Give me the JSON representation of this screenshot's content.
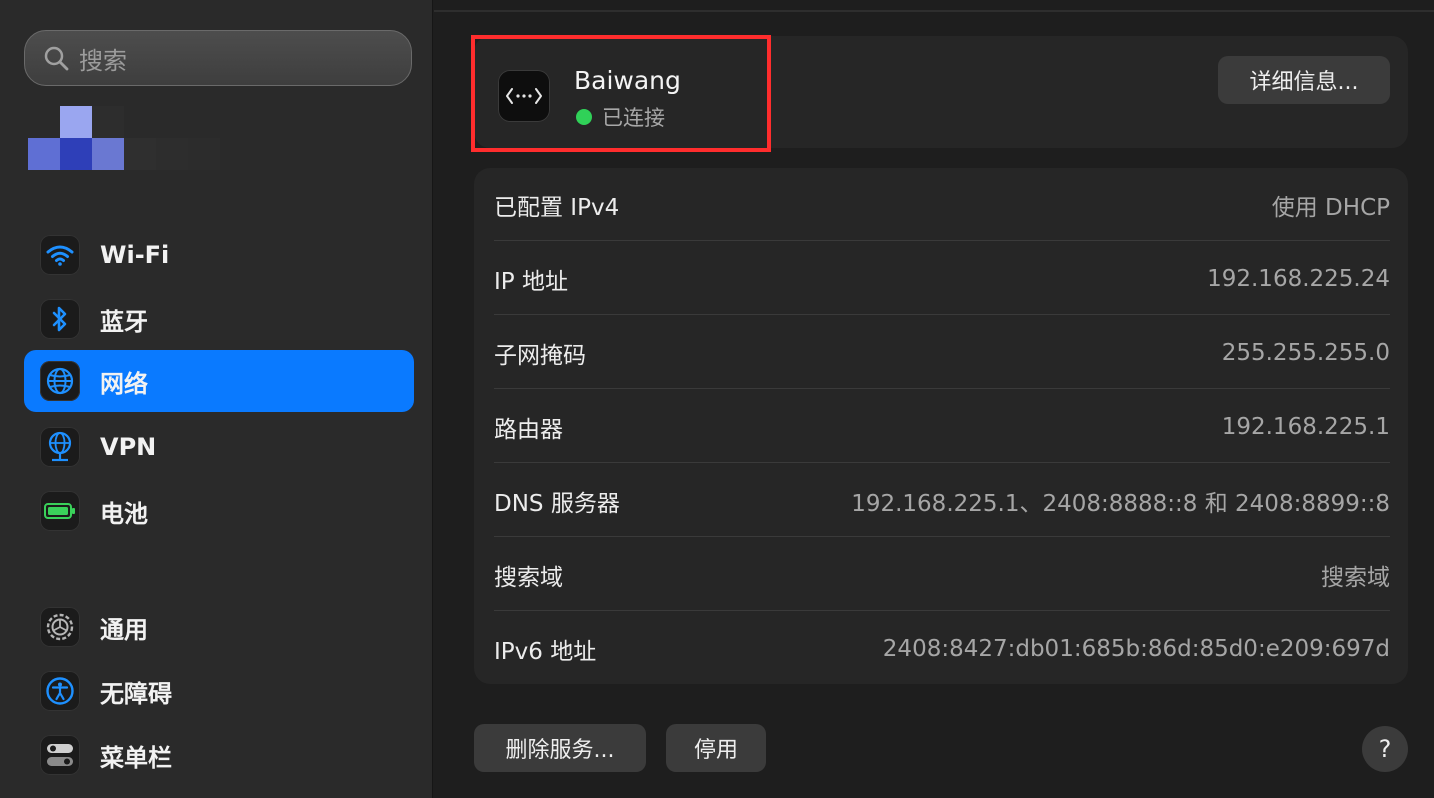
{
  "sidebar": {
    "search_placeholder": "搜索",
    "items": [
      {
        "label": "Wi-Fi",
        "icon": "wifi-icon"
      },
      {
        "label": "蓝牙",
        "icon": "bluetooth-icon"
      },
      {
        "label": "网络",
        "icon": "globe-icon",
        "active": true
      },
      {
        "label": "VPN",
        "icon": "vpn-globe-icon"
      },
      {
        "label": "电池",
        "icon": "battery-icon"
      },
      {
        "label": "通用",
        "icon": "gear-icon"
      },
      {
        "label": "无障碍",
        "icon": "accessibility-icon"
      },
      {
        "label": "菜单栏",
        "icon": "menubar-toggle-icon"
      }
    ]
  },
  "connection": {
    "name": "Baiwang",
    "status": "已连接",
    "status_color": "#30d158",
    "details_button": "详细信息..."
  },
  "info_rows": [
    {
      "key": "已配置 IPv4",
      "value": "使用 DHCP"
    },
    {
      "key": "IP 地址",
      "value": "192.168.225.24"
    },
    {
      "key": "子网掩码",
      "value": "255.255.255.0"
    },
    {
      "key": "路由器",
      "value": "192.168.225.1"
    },
    {
      "key": "DNS 服务器",
      "value": "192.168.225.1、2408:8888::8 和 2408:8899::8"
    },
    {
      "key": "搜索域",
      "value": "搜索域"
    },
    {
      "key": "IPv6 地址",
      "value": "2408:8427:db01:685b:86d:85d0:e209:697d"
    }
  ],
  "footer": {
    "delete_button": "删除服务...",
    "disable_button": "停用",
    "help_button": "?"
  },
  "colors": {
    "accent": "#0a7aff",
    "highlight_box": "#ff2d2d"
  }
}
